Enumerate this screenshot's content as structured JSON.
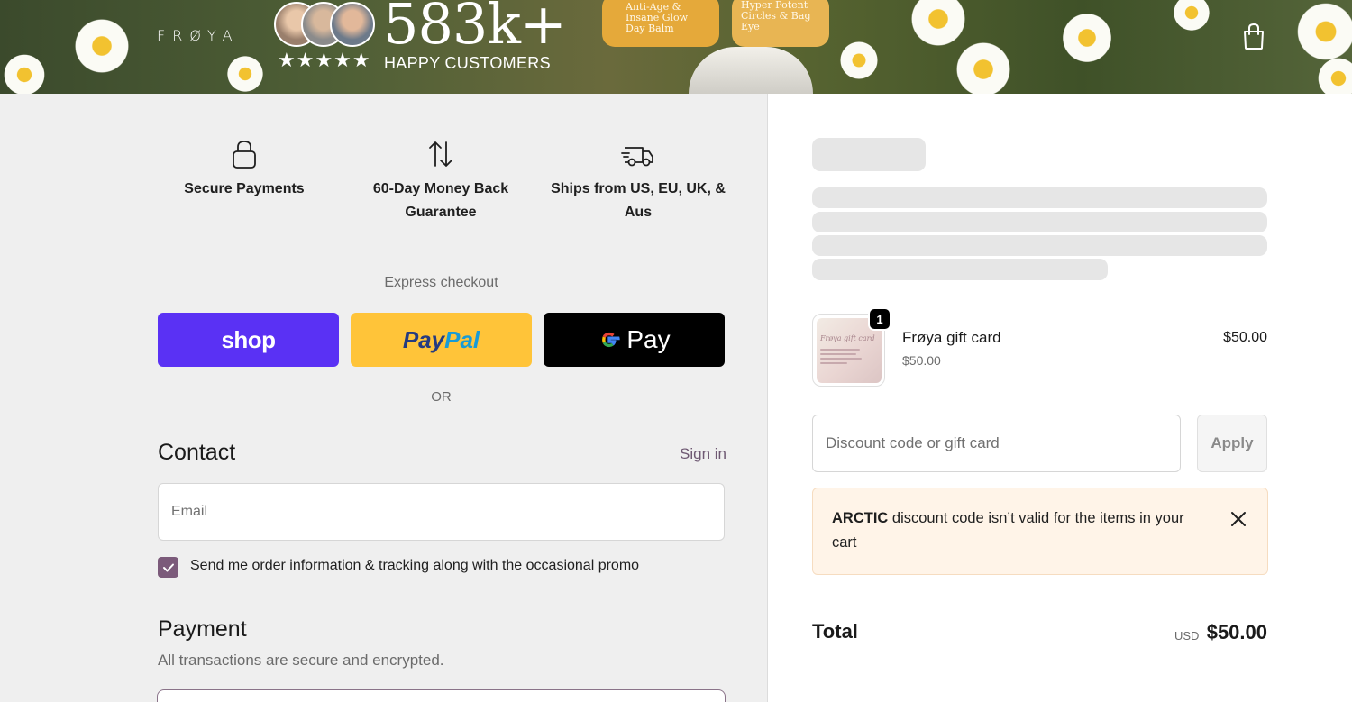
{
  "header": {
    "logo_text": "FRØYA",
    "customer_count": "583k+",
    "rating_stars": "★★★★★",
    "happy_customers": "HAPPY CUSTOMERS",
    "product_labels": [
      "Anti-Age & Insane Glow Day Balm",
      "Hyper Potent Circles & Bag Eye"
    ]
  },
  "features": [
    {
      "label": "Secure Payments",
      "icon": "lock-icon"
    },
    {
      "label": "60-Day Money Back Guarantee",
      "icon": "arrows-up-down-icon"
    },
    {
      "label": "Ships from US, EU, UK, & Aus",
      "icon": "delivery-truck-icon"
    }
  ],
  "express_checkout": {
    "title": "Express checkout",
    "shop_label": "shop",
    "paypal_pay": "Pay",
    "paypal_pal": "Pal",
    "gpay_label": "Pay",
    "or_text": "OR"
  },
  "contact": {
    "title": "Contact",
    "signin_label": "Sign in",
    "email_placeholder": "Email",
    "marketing_checked": true,
    "marketing_label": "Send me order information & tracking along with the occasional promo"
  },
  "payment": {
    "title": "Payment",
    "subtitle": "All transactions are secure and encrypted."
  },
  "order_summary": {
    "item": {
      "name": "Frøya gift card",
      "variant": "$50.00",
      "price": "$50.00",
      "quantity": "1",
      "card_image_text": "Frøya gift card"
    },
    "discount_placeholder": "Discount code or gift card",
    "apply_label": "Apply",
    "alert": {
      "code": "ARCTIC",
      "message": " discount code isn’t valid for the items in your cart"
    },
    "total_label": "Total",
    "currency": "USD",
    "total_amount": "$50.00"
  },
  "colors": {
    "shop_purple": "#5a31f4",
    "paypal_yellow": "#ffc439",
    "gpay_black": "#000000",
    "accent_mauve": "#7b5a7a",
    "alert_bg": "#fff4e8"
  }
}
